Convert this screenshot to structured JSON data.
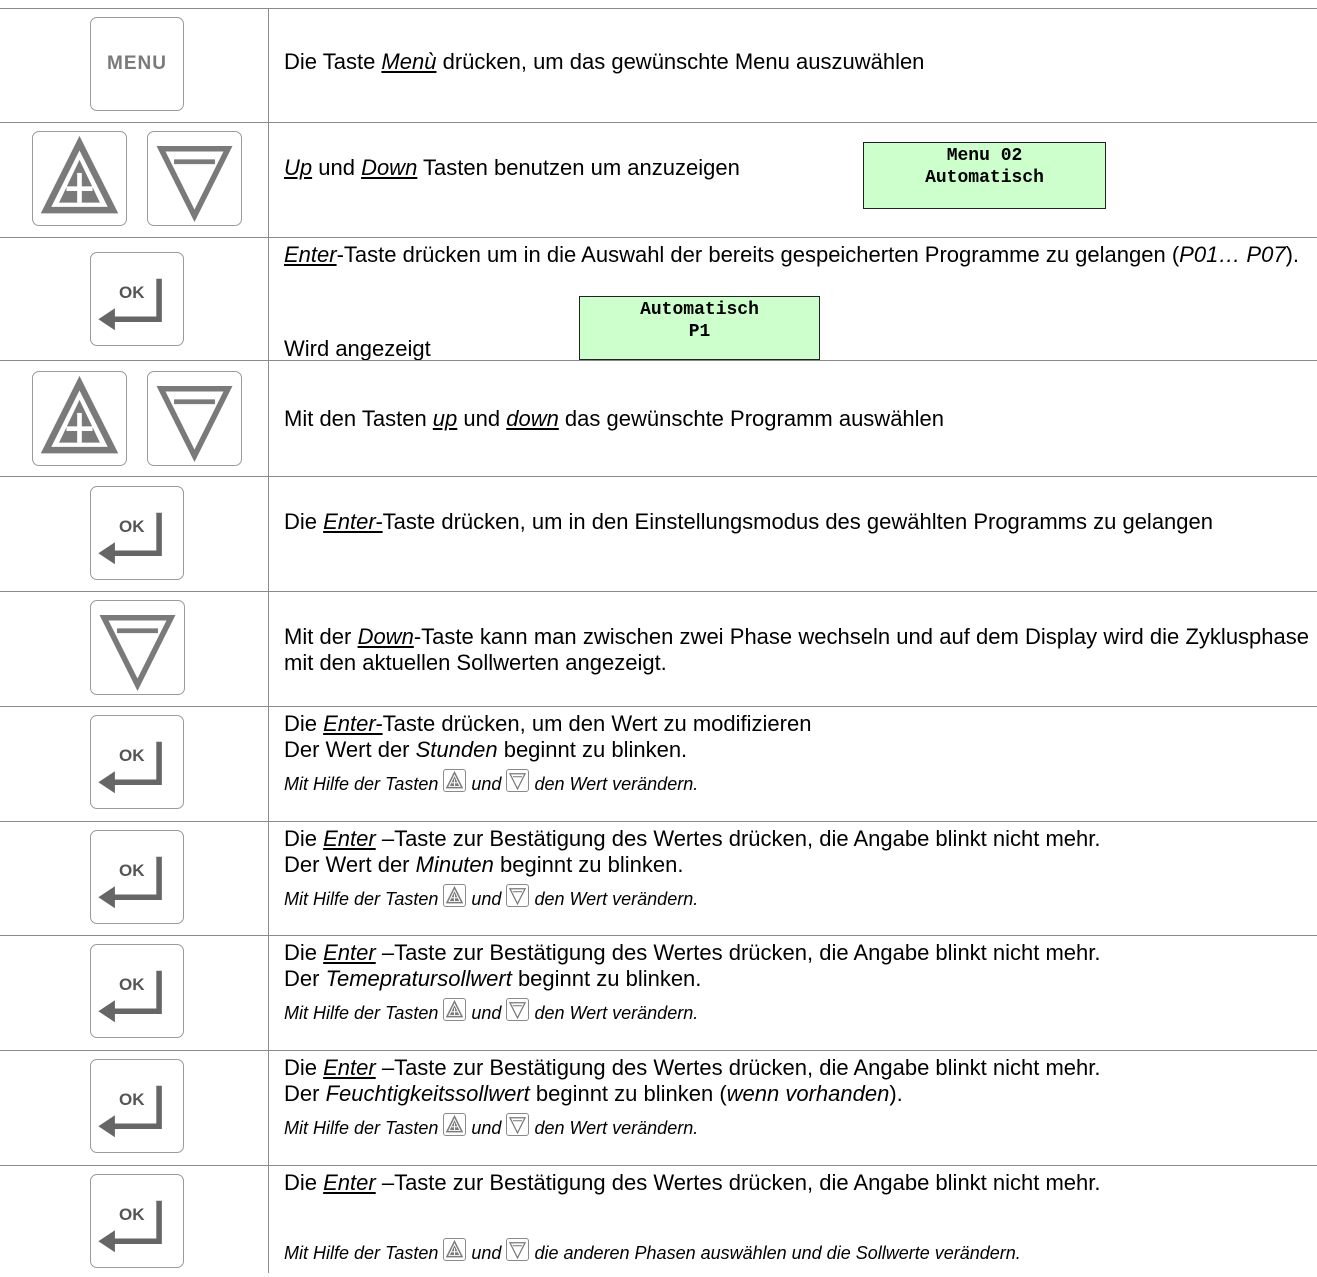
{
  "keys": {
    "menu_label": "MENU",
    "ok_label": "OK"
  },
  "rows": [
    {
      "pre": "Die Taste ",
      "link": "Menù",
      "post": " drücken, um das gewünschte Menu auszuwählen"
    },
    {
      "link1": "Up",
      "mid": " und ",
      "link2": "Down",
      "post": " Tasten benutzen um anzuzeigen",
      "lcd": [
        "Menu 02",
        "Automatisch"
      ]
    },
    {
      "link": "Enter",
      "post": "-Taste drücken um in die Auswahl der bereits gespeicherten Programme zu gelangen (",
      "prog": "P01… P07",
      "end": ").",
      "line2": "Wird angezeigt",
      "lcd": [
        "Automatisch",
        "P1"
      ]
    },
    {
      "pre": "Mit den Tasten ",
      "link1": "up",
      "mid": " und ",
      "link2": "down",
      "post": " das gewünschte Programm auswählen"
    },
    {
      "pre": "Die ",
      "link": "Enter-",
      "post": "Taste drücken, um in den Einstellungsmodus des gewählten Programms zu gelangen"
    },
    {
      "pre": "Mit der ",
      "link": "Down",
      "post": "-Taste kann man zwischen zwei Phase wechseln und auf dem Display wird die Zyklusphase mit den aktuellen Sollwerten angezeigt."
    },
    {
      "pre": "Die ",
      "link": "Enter-",
      "post": "Taste drücken, um den Wert zu modifizieren",
      "l2pre": "Der Wert der ",
      "l2it": "Stunden",
      "l2post": " beginnt zu blinken.",
      "hint_pre": "Mit Hilfe der Tasten ",
      "hint_mid": " und ",
      "hint_post": " den Wert verändern."
    },
    {
      "pre": "Die ",
      "link": "Enter",
      "post": " –Taste zur Bestätigung des Wertes drücken, die Angabe blinkt nicht mehr.",
      "l2pre": "Der Wert der ",
      "l2it": "Minuten",
      "l2post": " beginnt zu blinken.",
      "hint_pre": "Mit Hilfe der Tasten ",
      "hint_mid": " und ",
      "hint_post": " den Wert verändern."
    },
    {
      "pre": "Die ",
      "link": "Enter",
      "post": " –Taste zur Bestätigung des Wertes drücken, die Angabe blinkt nicht mehr.",
      "l2pre": "Der ",
      "l2it": "Temepratursollwert",
      "l2post": " beginnt zu blinken.",
      "hint_pre": "Mit Hilfe der Tasten ",
      "hint_mid": " und ",
      "hint_post": " den Wert verändern."
    },
    {
      "pre": "Die ",
      "link": "Enter",
      "post": " –Taste zur Bestätigung des Wertes drücken, die Angabe blinkt nicht mehr.",
      "l2pre": "Der ",
      "l2it": "Feuchtigkeitssollwert",
      "l2mid": " beginnt zu blinken (",
      "l2it2": "wenn vorhanden",
      "l2post": ").",
      "hint_pre": "Mit Hilfe der Tasten ",
      "hint_mid": " und ",
      "hint_post": " den Wert verändern."
    },
    {
      "pre": "Die ",
      "link": "Enter",
      "post": " –Taste zur Bestätigung des Wertes drücken, die Angabe blinkt nicht mehr.",
      "hint_pre": "Mit Hilfe der Tasten ",
      "hint_mid": " und ",
      "hint_post": " die anderen Phasen auswählen und die Sollwerte verändern."
    }
  ]
}
